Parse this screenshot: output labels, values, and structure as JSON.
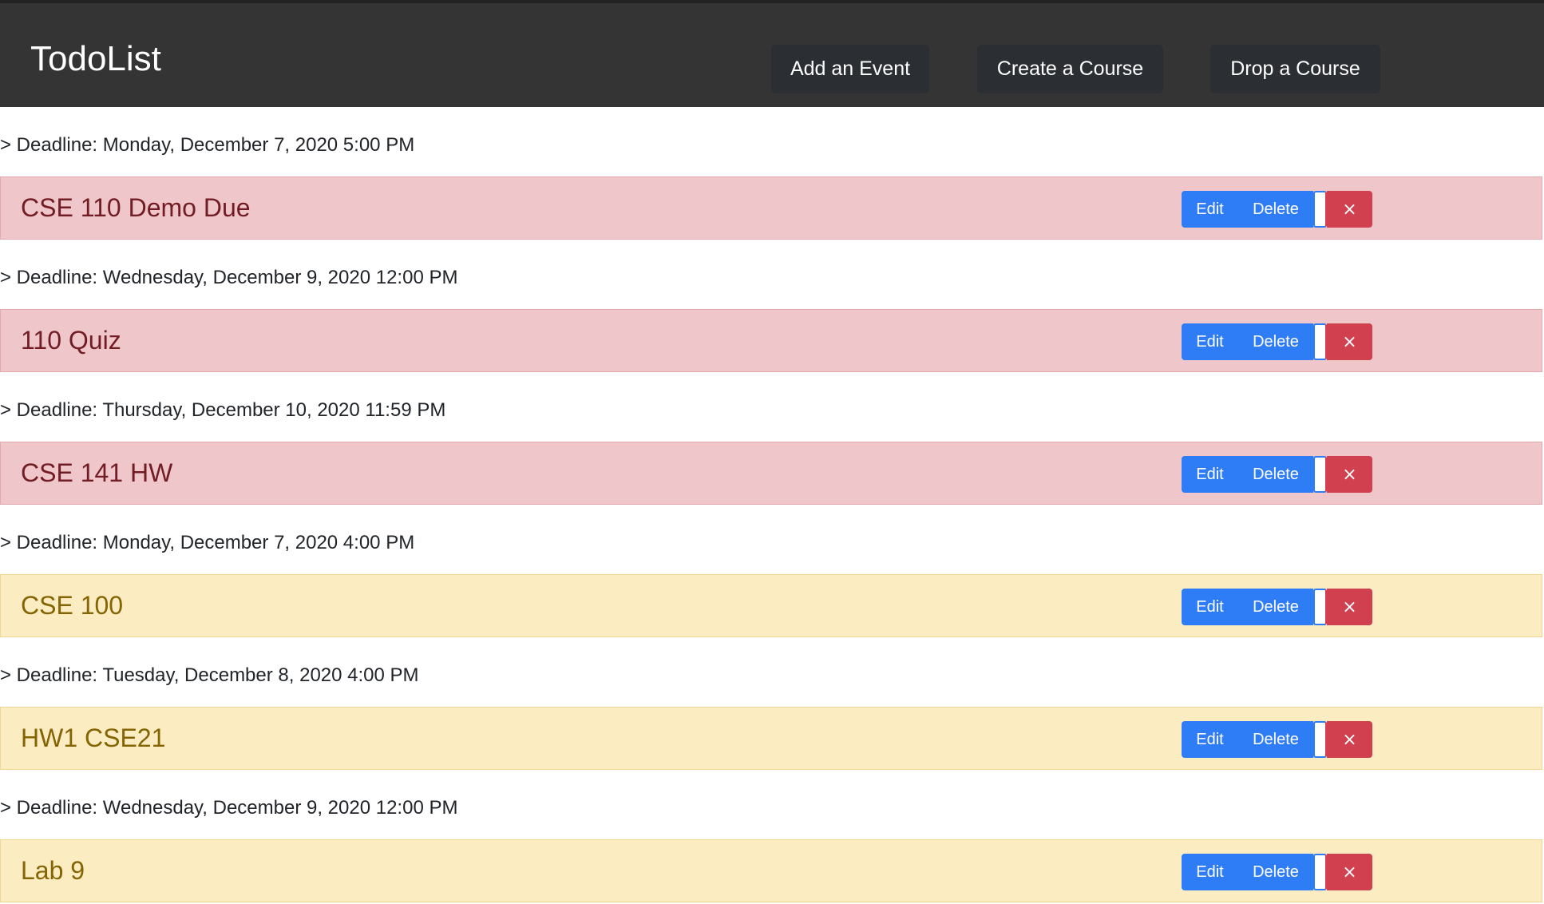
{
  "navbar": {
    "brand": "TodoList",
    "add_event": "Add an Event",
    "create_course": "Create a Course",
    "drop_course": "Drop a Course"
  },
  "colors": {
    "navbar_bg": "#343434",
    "danger_row": "#efc6ca",
    "warning_row": "#fcecc1",
    "primary_button": "#2f7df6",
    "danger_button": "#d0404f"
  },
  "icons": {
    "close": "close-icon"
  },
  "events": [
    {
      "deadline": "> Deadline: Monday, December 7, 2020 5:00 PM",
      "title": "CSE 110 Demo Due",
      "status": "danger",
      "edit": "Edit",
      "delete": "Delete",
      "close": "×"
    },
    {
      "deadline": "> Deadline: Wednesday, December 9, 2020 12:00 PM",
      "title": "110 Quiz",
      "status": "danger",
      "edit": "Edit",
      "delete": "Delete",
      "close": "×"
    },
    {
      "deadline": "> Deadline: Thursday, December 10, 2020 11:59 PM",
      "title": "CSE 141 HW",
      "status": "danger",
      "edit": "Edit",
      "delete": "Delete",
      "close": "×"
    },
    {
      "deadline": "> Deadline: Monday, December 7, 2020 4:00 PM",
      "title": "CSE 100",
      "status": "warning",
      "edit": "Edit",
      "delete": "Delete",
      "close": "×"
    },
    {
      "deadline": "> Deadline: Tuesday, December 8, 2020 4:00 PM",
      "title": "HW1 CSE21",
      "status": "warning",
      "edit": "Edit",
      "delete": "Delete",
      "close": "×"
    },
    {
      "deadline": "> Deadline: Wednesday, December 9, 2020 12:00 PM",
      "title": "Lab 9",
      "status": "warning",
      "edit": "Edit",
      "delete": "Delete",
      "close": "×"
    }
  ]
}
